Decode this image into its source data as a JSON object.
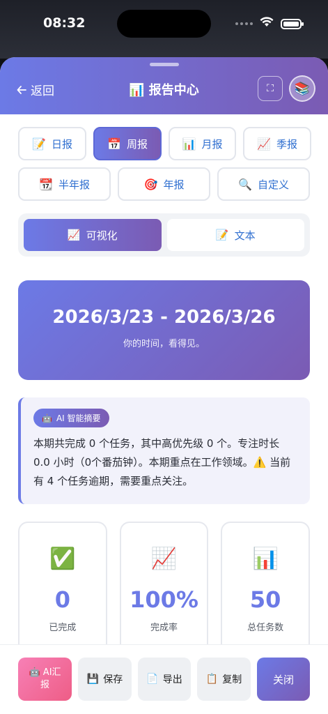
{
  "status_bar": {
    "time": "08:32"
  },
  "header": {
    "back_label": "返回",
    "title": "报告中心",
    "title_icon": "📊",
    "avatar_icon": "📚",
    "expand_icon": "⛶"
  },
  "periods": [
    {
      "icon": "📝",
      "label": "日报",
      "active": false
    },
    {
      "icon": "📅",
      "label": "周报",
      "active": true
    },
    {
      "icon": "📊",
      "label": "月报",
      "active": false
    },
    {
      "icon": "📈",
      "label": "季报",
      "active": false
    },
    {
      "icon": "📆",
      "label": "半年报",
      "active": false
    },
    {
      "icon": "🎯",
      "label": "年报",
      "active": false
    },
    {
      "icon": "🔍",
      "label": "自定义",
      "active": false
    }
  ],
  "modes": [
    {
      "icon": "📈",
      "label": "可视化",
      "active": true
    },
    {
      "icon": "📝",
      "label": "文本",
      "active": false
    }
  ],
  "date_card": {
    "range": "2026/3/23 - 2026/3/26",
    "tagline": "你的时间，看得见。"
  },
  "summary": {
    "tag_icon": "🤖",
    "tag_label": "AI 智能摘要",
    "text": "本期共完成 0 个任务，其中高优先级 0 个。专注时长 0.0 小时（0个番茄钟）。本期重点在工作领域。⚠️ 当前有 4 个任务逾期，需要重点关注。"
  },
  "stats": [
    {
      "icon": "✅",
      "value": "0",
      "label": "已完成"
    },
    {
      "icon": "📈",
      "value": "100%",
      "label": "完成率"
    },
    {
      "icon": "📊",
      "value": "50",
      "label": "总任务数"
    }
  ],
  "footer": {
    "ai_icon": "🤖",
    "ai_label_1": "AI汇",
    "ai_label_2": "报",
    "save_icon": "💾",
    "save_label": "保存",
    "export_icon": "📄",
    "export_label": "导出",
    "copy_icon": "📋",
    "copy_label": "复制",
    "close_label": "关闭"
  },
  "colors": {
    "accent_start": "#6c7ae6",
    "accent_end": "#7b5bb3",
    "link": "#2f6fd0",
    "ai_pink": "#ee5d86"
  }
}
